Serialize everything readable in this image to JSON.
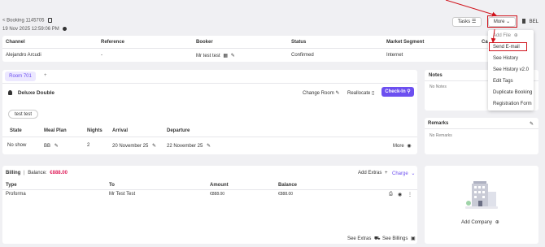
{
  "header": {
    "booking_ref": "< Booking 1145705",
    "datetime": "19 Nov 2025 12:59:06 PM",
    "tasks_label": "Tasks",
    "more_label": "More",
    "user_initials": "BEL"
  },
  "more_menu": {
    "items": [
      {
        "label": "Add File"
      },
      {
        "label": "Send E-mail"
      },
      {
        "label": "See History"
      },
      {
        "label": "See History v2.0"
      },
      {
        "label": "Edit Tags"
      },
      {
        "label": "Duplicate Booking"
      },
      {
        "label": "Registration Form"
      }
    ]
  },
  "booking_table": {
    "columns": [
      "Channel",
      "Reference",
      "Booker",
      "Status",
      "Market Segment",
      "Ca"
    ],
    "row": {
      "channel": "Alejandro Arcudi",
      "reference": "-",
      "booker": "Mr test test",
      "status": "Confirmed",
      "market_segment": "Internet"
    }
  },
  "room": {
    "tab_label": "Room 701",
    "add_tab": "+",
    "room_type": "Deluxe Double",
    "change_room": "Change Room",
    "reallocate": "Reallocate",
    "check_in": "Check-In",
    "guest_chip": "test test",
    "columns": [
      "State",
      "Meal Plan",
      "Nights",
      "Arrival",
      "Departure"
    ],
    "row": {
      "state": "No show",
      "meal_plan": "BB",
      "nights": "2",
      "arrival": "20 November 25",
      "departure": "22 November 25"
    },
    "more_label": "More"
  },
  "notes": {
    "title": "Notes",
    "empty": "No Notes"
  },
  "remarks": {
    "title": "Remarks",
    "empty": "No Remarks"
  },
  "billing": {
    "title": "Billing",
    "balance_label": "Balance:",
    "balance_value": "€888.00",
    "add_extras": "Add Extras",
    "charge": "Charge",
    "columns": [
      "Type",
      "To",
      "Amount",
      "Balance"
    ],
    "row": {
      "type": "Proforma",
      "to": "Mr Test Test",
      "amount": "€888.00",
      "balance": "€888.00"
    },
    "see_extras": "See Extras",
    "see_billings": "See Billings"
  },
  "company": {
    "add_label": "Add Company"
  },
  "colors": {
    "accent": "#6c4ff0",
    "balance": "#e0245e",
    "annotation": "#d0121b"
  }
}
